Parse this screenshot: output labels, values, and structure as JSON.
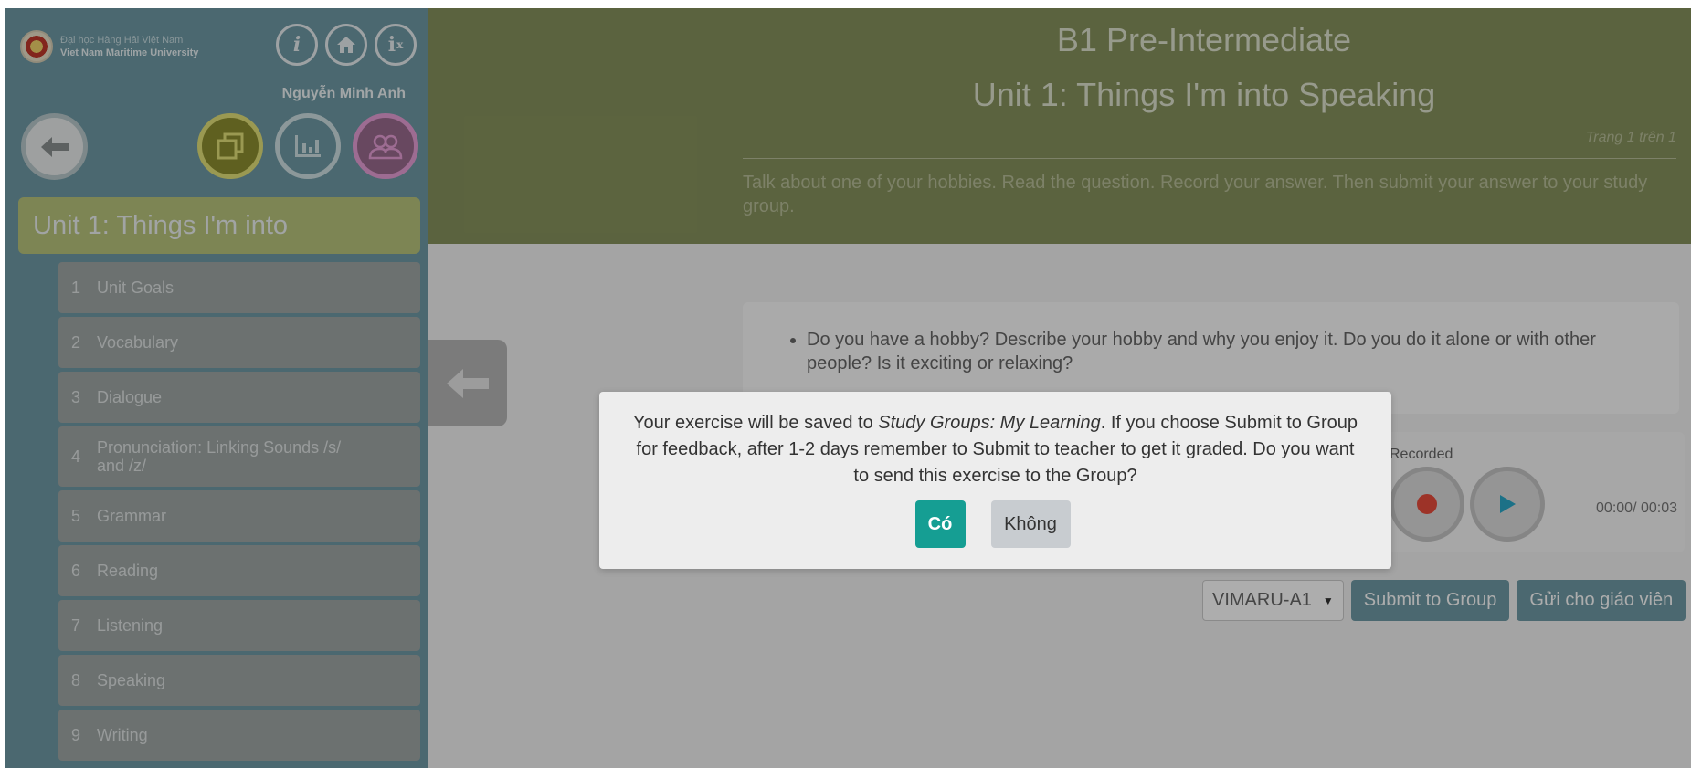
{
  "sidebar": {
    "logo": {
      "vi": "Đại học Hàng Hải Việt Nam",
      "en": "Viet Nam Maritime University"
    },
    "top_icons": [
      "info-icon",
      "home-icon",
      "accessibility-icon"
    ],
    "user_name": "Nguyễn Minh Anh",
    "nav_icons": [
      "back-icon",
      "copy-icon",
      "chart-icon",
      "group-icon"
    ],
    "unit_header": "Unit 1: Things I'm into",
    "items": [
      {
        "num": "1",
        "label": "Unit Goals"
      },
      {
        "num": "2",
        "label": "Vocabulary"
      },
      {
        "num": "3",
        "label": "Dialogue"
      },
      {
        "num": "4",
        "label": "Pronunciation: Linking Sounds /s/ and /z/"
      },
      {
        "num": "5",
        "label": "Grammar"
      },
      {
        "num": "6",
        "label": "Reading"
      },
      {
        "num": "7",
        "label": "Listening"
      },
      {
        "num": "8",
        "label": "Speaking"
      },
      {
        "num": "9",
        "label": "Writing"
      }
    ]
  },
  "header": {
    "course": "B1 Pre-Intermediate",
    "unit": "Unit 1: Things I'm into Speaking",
    "page_info": "Trang 1 trên 1",
    "instructions": "Talk about one of your hobbies. Read the question. Record your answer. Then submit your answer to your study group."
  },
  "question": {
    "text": "Do you have a hobby? Describe your hobby and why you enjoy it. Do you do it alone or with other people? Is it exciting or relaxing?"
  },
  "recorder": {
    "label": "Recorded",
    "time": "00:00/ 00:03"
  },
  "actions": {
    "group_value": "VIMARU-A1",
    "submit_group": "Submit to Group",
    "send_teacher": "Gửi cho giáo viên"
  },
  "modal": {
    "text_before": "Your exercise will be saved to ",
    "text_italic": "Study Groups: My Learning",
    "text_after": ". If you choose Submit to Group for feedback, after 1-2 days remember to Submit to teacher to get it graded. Do you want to send this exercise to the Group?",
    "yes": "Có",
    "no": "Không"
  },
  "colors": {
    "sidebar": "#6f9aa5",
    "header": "#87935d",
    "unit_header": "#b9c47c",
    "yes_button": "#159e93",
    "no_button": "#c8ccd0"
  }
}
